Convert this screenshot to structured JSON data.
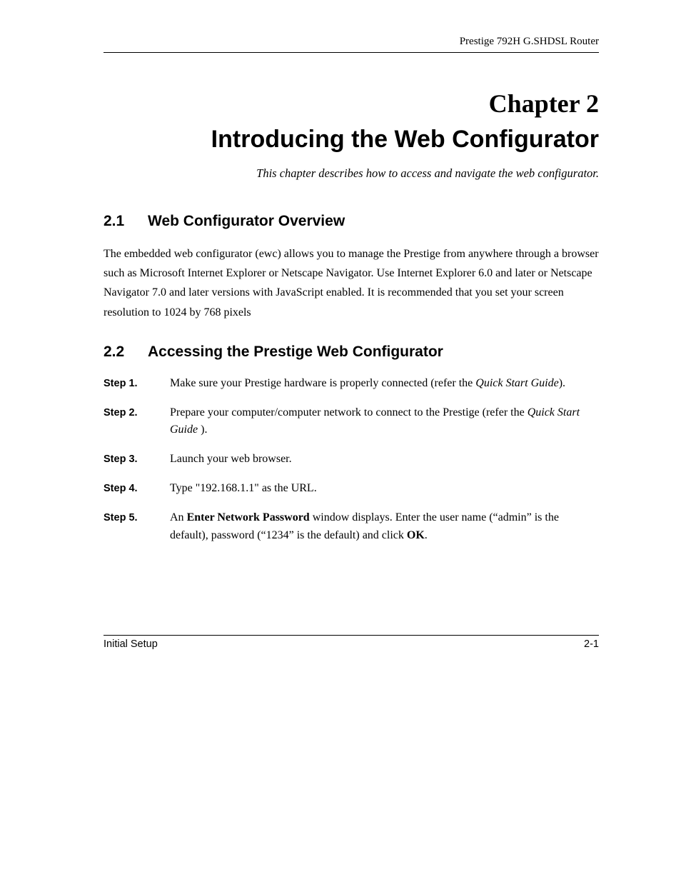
{
  "header": {
    "product": "Prestige 792H G.SHDSL Router"
  },
  "chapter": {
    "number": "Chapter 2",
    "title": "Introducing the Web Configurator",
    "subtitle": "This chapter describes how to access and navigate the web configurator."
  },
  "sections": {
    "s1": {
      "number": "2.1",
      "title": "Web Configurator Overview",
      "paragraph": "The embedded web configurator (ewc) allows you to manage the Prestige from anywhere through a browser such as Microsoft Internet Explorer or Netscape Navigator. Use Internet Explorer 6.0 and later or Netscape Navigator 7.0 and later versions with JavaScript enabled. It is recommended that you set your screen resolution to 1024 by 768 pixels"
    },
    "s2": {
      "number": "2.2",
      "title": "Accessing the Prestige Web Configurator",
      "steps": {
        "step1": {
          "label": "Step 1.",
          "text_a": "Make sure your Prestige hardware is properly connected (refer the ",
          "text_italic": "Quick Start Guide",
          "text_b": ")."
        },
        "step2": {
          "label": "Step 2.",
          "text_a": "Prepare your computer/computer network to connect to the Prestige (refer the ",
          "text_italic": "Quick Start Guide",
          "text_b": " )."
        },
        "step3": {
          "label": "Step 3.",
          "text": "Launch your web browser."
        },
        "step4": {
          "label": "Step 4.",
          "text": "Type \"192.168.1.1\" as the URL."
        },
        "step5": {
          "label": "Step 5.",
          "text_a": "An ",
          "text_bold1": "Enter Network Password",
          "text_b": " window displays. Enter the user name (“admin” is the default), password (“1234” is the default) and click ",
          "text_bold2": "OK",
          "text_c": "."
        }
      }
    }
  },
  "footer": {
    "left": "Initial Setup",
    "right": "2-1"
  }
}
